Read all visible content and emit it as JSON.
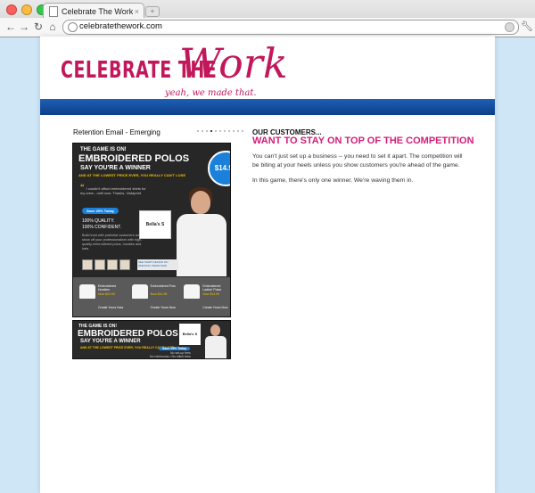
{
  "browser": {
    "tab_title": "Celebrate The Work",
    "tab_close": "×",
    "new_tab": "+",
    "url": "celebratethework.com",
    "traffic_light_colors": [
      "#fc605c",
      "#fdbc40",
      "#34c84a"
    ]
  },
  "header": {
    "logo_main": "CELEBRATE THE",
    "logo_script": "Work",
    "tagline": "yeah, we made that."
  },
  "left": {
    "section_title": "Retention Email - Emerging",
    "slides_total": 11,
    "slide_active": 3
  },
  "email": {
    "line1": "THE GAME IS ON!",
    "line2": "EMBROIDERED POLOS",
    "line3": "SAY YOU'RE A WINNER",
    "line4": "AND AT THE LOWEST PRICE EVER, YOU REALLY CAN'T LOSE",
    "badge_price": "$14.99",
    "quote": "I couldn't afford embroidered shirts for my crew - until now. Thanks, Vistaprint",
    "save_pill": "Save 25% Today",
    "quality_1": "100% QUALITY.",
    "quality_2": "100% CONFIDENT.",
    "body": "Build trust with potential customers and show off your professionalism with high-quality embroidered polos, hoodies and hats.",
    "card_label": "Bella's S",
    "design_note": "SEE SHIRT DESIGN ON SPECIFIC ITEMS NOW",
    "products": [
      {
        "name": "Embroidered Hoodies",
        "price": "Now $34.99",
        "link": "Create Yours Now"
      },
      {
        "name": "Embroidered Polo",
        "price": "Now $14.99",
        "link": "Create Yours Now"
      },
      {
        "name": "Embroidered Ladies' Polos",
        "price": "Now $14.99",
        "link": "Create Yours Now"
      }
    ]
  },
  "banner": {
    "line1": "THE GAME IS ON!",
    "line2": "EMBROIDERED POLOS",
    "line3": "SAY YOU'RE A WINNER",
    "line4": "AND AT THE LOWEST PRICE EVER, YOU REALLY CAN'T LOSE",
    "card_label": "Bella's S",
    "save": "Save 25% Today",
    "note1": "No set-up fees",
    "note2": "No minimums • No stitch fees"
  },
  "right": {
    "label": "OUR CUSTOMERS...",
    "headline": "WANT TO STAY ON TOP OF THE COMPETITION",
    "para1": "You can't just set up a business -- you need to set it apart. The competition will be biting at your heels unless you show customers you're ahead of the game.",
    "para2": "In this game, there's only one winner. We're waving them in."
  },
  "colors": {
    "brand_magenta": "#c2185b",
    "headline_pink": "#d11e79",
    "bar_blue": "#0d4a9c",
    "page_bg": "#cfe6f7"
  }
}
